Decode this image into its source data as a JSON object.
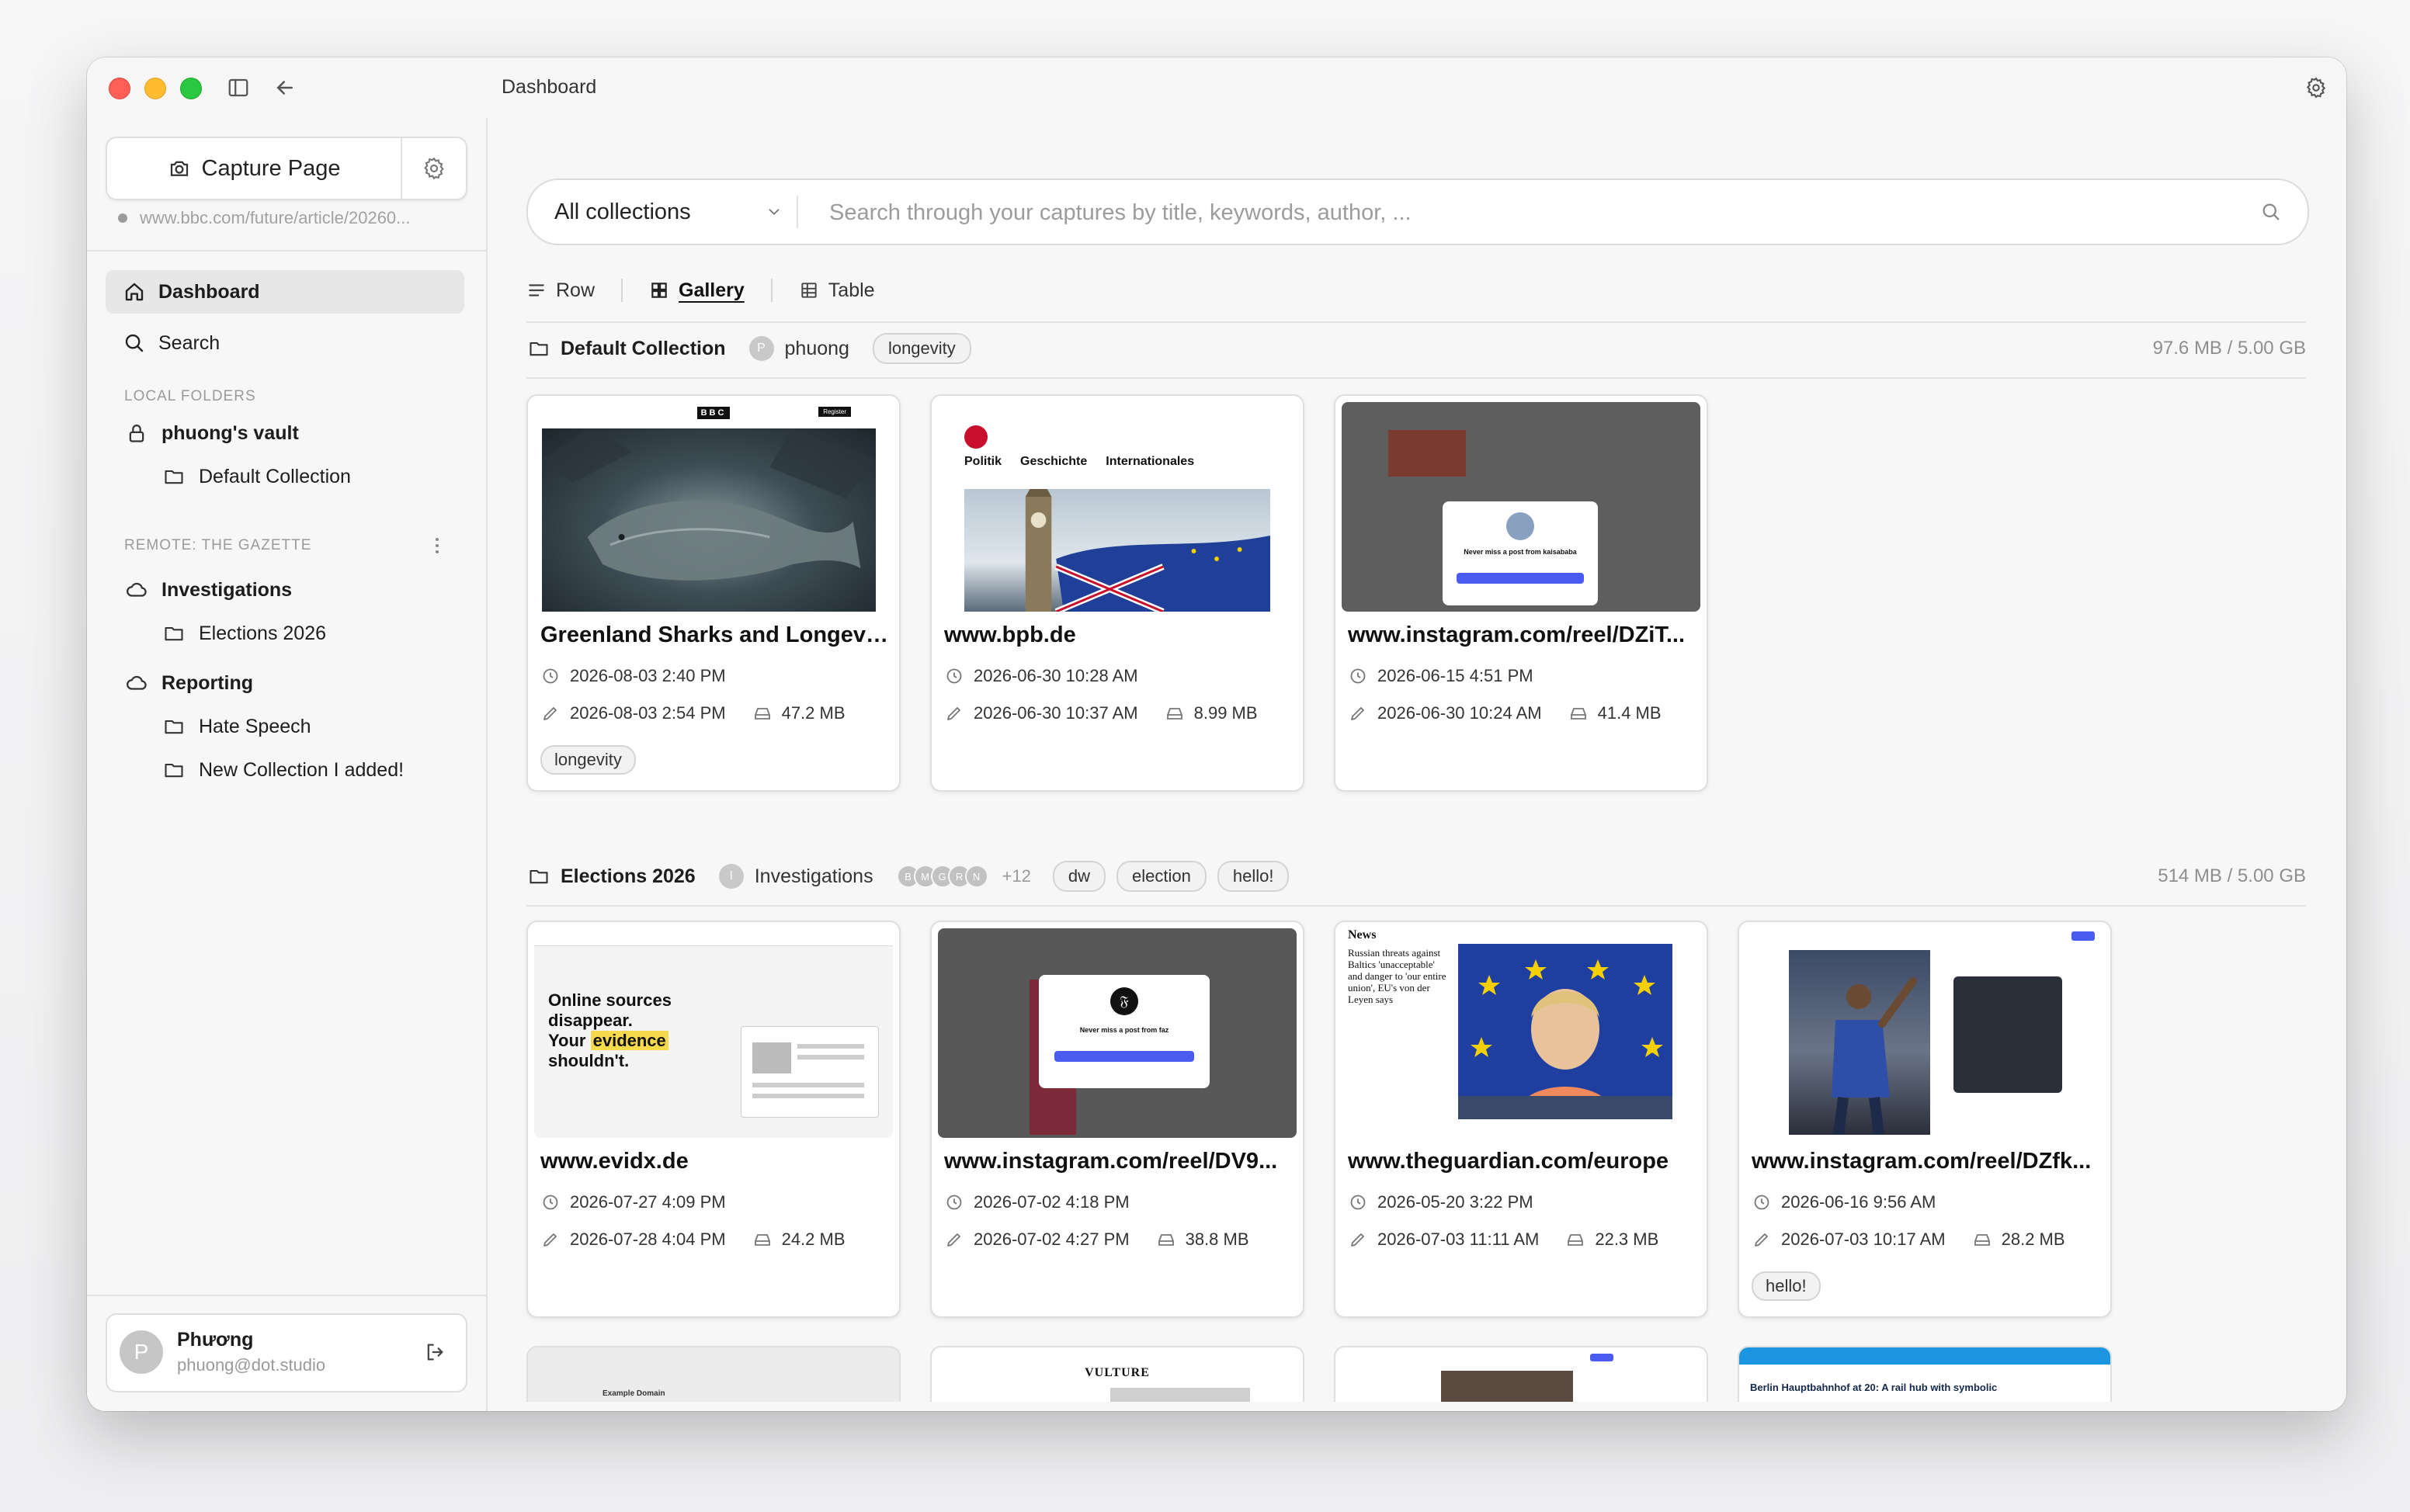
{
  "window": {
    "title": "Dashboard"
  },
  "sidebar": {
    "capture_label": "Capture Page",
    "current_url": "www.bbc.com/future/article/20260...",
    "nav": [
      {
        "label": "Dashboard",
        "icon": "home-icon"
      },
      {
        "label": "Search",
        "icon": "search-icon"
      }
    ],
    "local_label": "LOCAL FOLDERS",
    "vault": "phuong's vault",
    "default_collection": "Default Collection",
    "remote_label": "REMOTE: THE GAZETTE",
    "investigations": "Investigations",
    "elections": "Elections 2026",
    "reporting": "Reporting",
    "hate_speech": "Hate Speech",
    "new_collection": "New Collection I added!",
    "user": {
      "initial": "P",
      "name": "Phương",
      "email": "phuong@dot.studio"
    }
  },
  "search": {
    "collection": "All collections",
    "placeholder": "Search through your captures by title, keywords, author, ..."
  },
  "views": {
    "row": "Row",
    "gallery": "Gallery",
    "table": "Table",
    "active": "Gallery"
  },
  "groups": [
    {
      "title": "Default Collection",
      "owner_initial": "P",
      "owner": "phuong",
      "tags": [
        "longevity"
      ],
      "storage": "97.6 MB / 5.00 GB",
      "cards": [
        {
          "title": "Greenland Sharks and Longevity",
          "created": "2026-08-03 2:40 PM",
          "edited": "2026-08-03 2:54 PM",
          "size": "47.2 MB",
          "tag": "longevity"
        },
        {
          "title": "www.bpb.de",
          "created": "2026-06-30 10:28 AM",
          "edited": "2026-06-30 10:37 AM",
          "size": "8.99 MB",
          "tag": ""
        },
        {
          "title": "www.instagram.com/reel/DZiT...",
          "created": "2026-06-15 4:51 PM",
          "edited": "2026-06-30 10:24 AM",
          "size": "41.4 MB",
          "tag": ""
        }
      ]
    },
    {
      "title": "Elections 2026",
      "owner_initial": "I",
      "owner": "Investigations",
      "members": [
        "B",
        "M",
        "G",
        "R",
        "N"
      ],
      "more": "+12",
      "tags": [
        "dw",
        "election",
        "hello!"
      ],
      "storage": "514 MB / 5.00 GB",
      "cards": [
        {
          "title": "www.evidx.de",
          "created": "2026-07-27 4:09 PM",
          "edited": "2026-07-28 4:04 PM",
          "size": "24.2 MB",
          "tag": ""
        },
        {
          "title": "www.instagram.com/reel/DV9...",
          "created": "2026-07-02 4:18 PM",
          "edited": "2026-07-02 4:27 PM",
          "size": "38.8 MB",
          "tag": ""
        },
        {
          "title": "www.theguardian.com/europe",
          "created": "2026-05-20 3:22 PM",
          "edited": "2026-07-03 11:11 AM",
          "size": "22.3 MB",
          "tag": ""
        },
        {
          "title": "www.instagram.com/reel/DZfk...",
          "created": "2026-06-16 9:56 AM",
          "edited": "2026-07-03 10:17 AM",
          "size": "28.2 MB",
          "tag": "hello!"
        }
      ]
    }
  ],
  "thumb_text": {
    "bbc": "BBC",
    "register": "Register",
    "bpb_nav": [
      "Politik",
      "Geschichte",
      "Internationales"
    ],
    "insta_modal": "Never miss a post from kaisababa",
    "insta_modal2": "Never miss a post from faz",
    "evidx_headline": [
      "Online sources",
      "disappear.",
      "Your",
      "evidence",
      "shouldn't."
    ],
    "guardian_label": "News",
    "guardian_headline": "Russian threats against Baltics 'unacceptable' and danger to 'our entire union', EU's von der Leyen says",
    "example_domain": "Example Domain",
    "vulture": "VULTURE",
    "berlin": "Berlin Hauptbahnhof at 20: A rail hub with symbolic"
  },
  "colors": {
    "accent": "#1d1d1f",
    "insta_blue": "#4a5cf0",
    "evidx_yellow": "#f7d94c"
  }
}
